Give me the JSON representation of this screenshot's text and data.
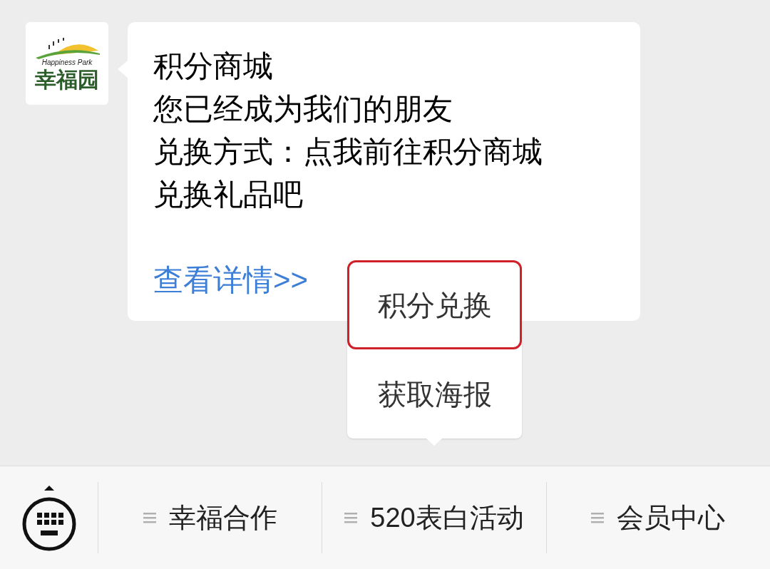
{
  "avatar": {
    "logo_text": "Happiness Park",
    "logo_name": "幸福园"
  },
  "message": {
    "lines": [
      "积分商城",
      "您已经成为我们的朋友",
      "兑换方式：点我前往积分商城",
      "兑换礼品吧"
    ],
    "link": "查看详情>>"
  },
  "popup_menu": [
    {
      "label": "积分兑换",
      "selected": true
    },
    {
      "label": "获取海报",
      "selected": false
    }
  ],
  "bottom_menu": [
    {
      "label": "幸福合作"
    },
    {
      "label": "520表白活动"
    },
    {
      "label": "会员中心"
    }
  ]
}
